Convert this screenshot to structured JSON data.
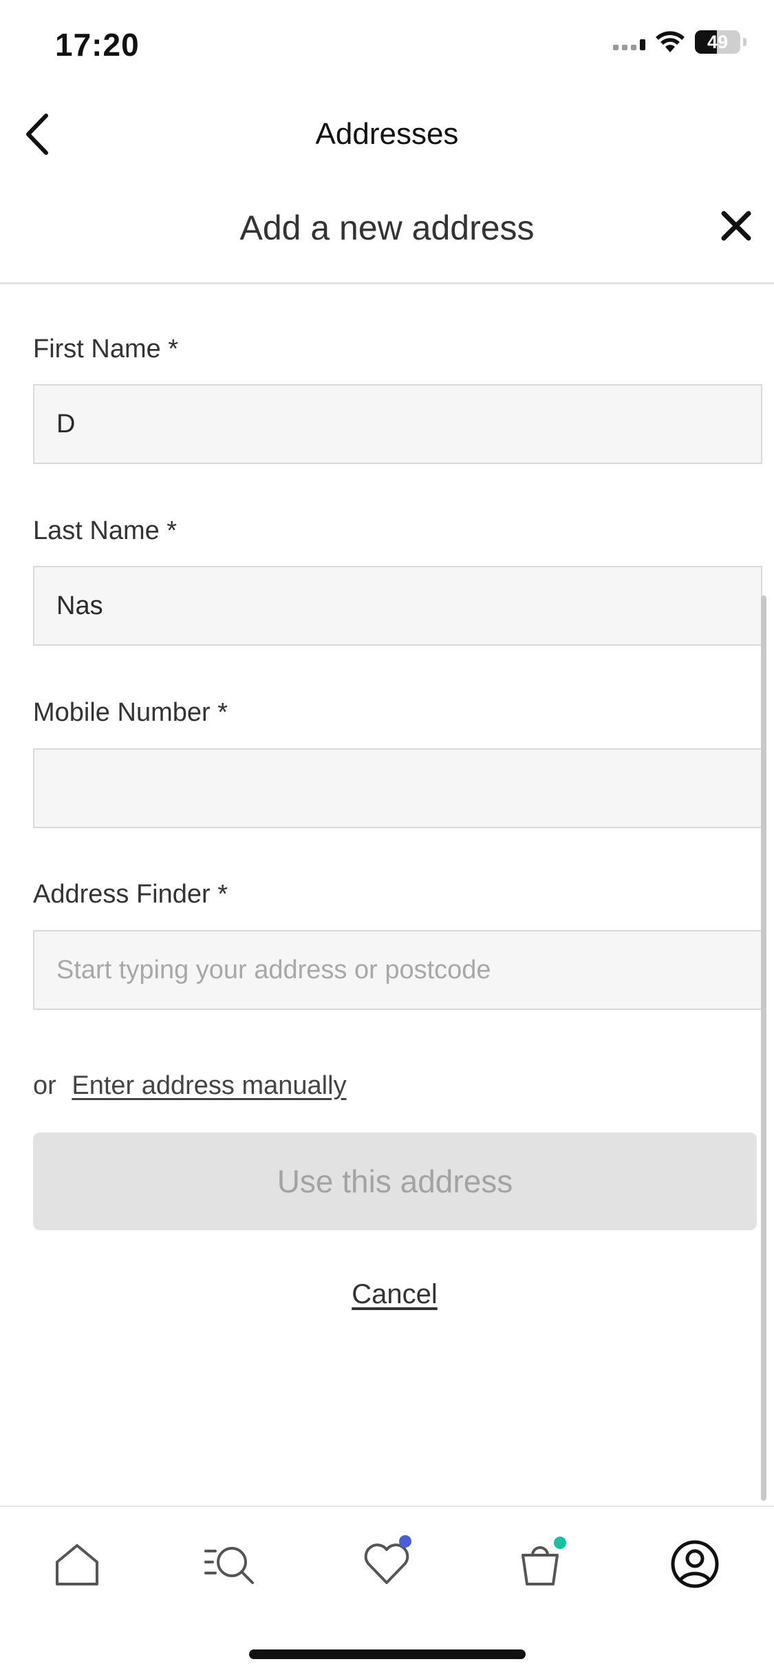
{
  "status_bar": {
    "time": "17:20",
    "battery": "49",
    "battery_level": 0.49
  },
  "header": {
    "title": "Addresses",
    "back_icon": "chevron-left-icon"
  },
  "sheet": {
    "title": "Add a new address",
    "close_icon": "close-icon",
    "fields": {
      "first_name": {
        "label": "First Name *",
        "value": "D"
      },
      "last_name": {
        "label": "Last Name *",
        "value": "Nas"
      },
      "mobile": {
        "label": "Mobile Number *",
        "value": ""
      },
      "address_finder": {
        "label": "Address Finder *",
        "value": "",
        "placeholder": "Start typing your address or postcode"
      }
    },
    "manual_prefix": "or",
    "manual_link": "Enter address manually",
    "submit_label": "Use this address",
    "cancel_label": "Cancel"
  },
  "tabbar": {
    "items": [
      {
        "icon": "home-icon"
      },
      {
        "icon": "search-icon"
      },
      {
        "icon": "heart-icon",
        "badge_color": "#4a5fd6"
      },
      {
        "icon": "bag-icon",
        "badge_color": "#17c2a4"
      },
      {
        "icon": "account-icon"
      }
    ]
  },
  "colors": {
    "badge_blue": "#4a5fd6",
    "badge_teal": "#17c2a4",
    "disabled_button": "#e2e2e2"
  }
}
